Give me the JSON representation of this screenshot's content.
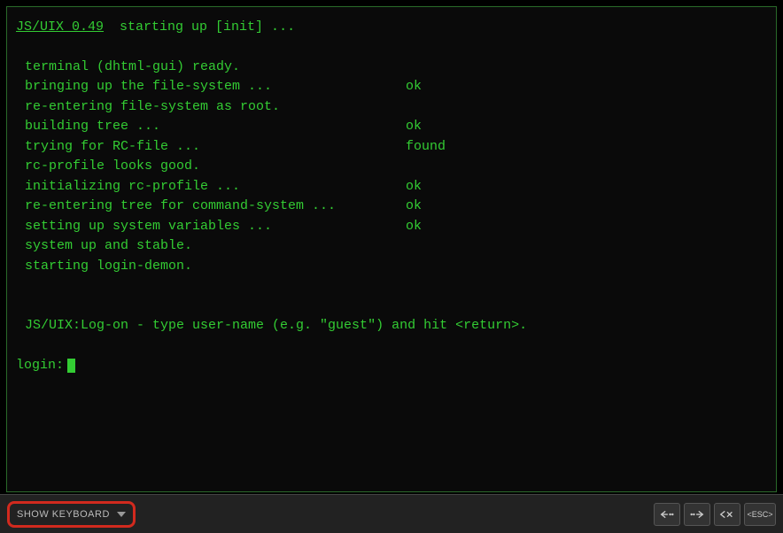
{
  "header": {
    "title": "JS/UIX 0.49",
    "suffix": "  starting up [init] ..."
  },
  "boot": [
    {
      "msg": "terminal (dhtml-gui) ready.",
      "status": ""
    },
    {
      "msg": "bringing up the file-system ...",
      "status": "ok"
    },
    {
      "msg": "re-entering file-system as root.",
      "status": ""
    },
    {
      "msg": "building tree ...",
      "status": "ok"
    },
    {
      "msg": "trying for RC-file ...",
      "status": "found"
    },
    {
      "msg": "rc-profile looks good.",
      "status": ""
    },
    {
      "msg": "initializing rc-profile ...",
      "status": "ok"
    },
    {
      "msg": "re-entering tree for command-system ...",
      "status": "ok"
    },
    {
      "msg": "setting up system variables ...",
      "status": "ok"
    },
    {
      "msg": "system up and stable.",
      "status": ""
    },
    {
      "msg": "starting login-demon.",
      "status": ""
    }
  ],
  "logon": {
    "instruction": "JS/UIX:Log-on - type user-name (e.g. \"guest\") and hit <return>.",
    "prompt": "login:"
  },
  "toolbar": {
    "show_keyboard": "SHOW KEYBOARD",
    "esc_label": "<ESC>"
  }
}
